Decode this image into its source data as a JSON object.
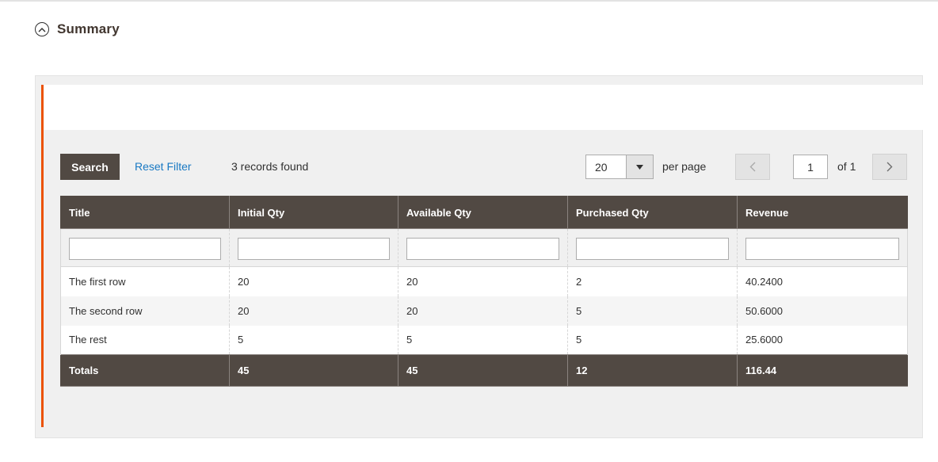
{
  "section": {
    "title": "Summary"
  },
  "toolbar": {
    "search_label": "Search",
    "reset_label": "Reset Filter",
    "records_text": "3 records found",
    "per_page_value": "20",
    "per_page_label": "per page",
    "current_page": "1",
    "of_pages": "of 1"
  },
  "grid": {
    "columns": [
      "Title",
      "Initial Qty",
      "Available Qty",
      "Purchased Qty",
      "Revenue"
    ],
    "rows": [
      [
        "The first row",
        "20",
        "20",
        "2",
        "40.2400"
      ],
      [
        "The second row",
        "20",
        "20",
        "5",
        "50.6000"
      ],
      [
        "The rest",
        "5",
        "5",
        "5",
        "25.6000"
      ]
    ],
    "totals": [
      "Totals",
      "45",
      "45",
      "12",
      "116.44"
    ]
  },
  "colors": {
    "header_bg": "#514943",
    "accent": "#eb5202",
    "link": "#1979c3"
  },
  "icons": {
    "collapse": "chevron-up-circle-icon",
    "dropdown": "triangle-down-icon",
    "prev": "chevron-left-icon",
    "next": "chevron-right-icon"
  }
}
